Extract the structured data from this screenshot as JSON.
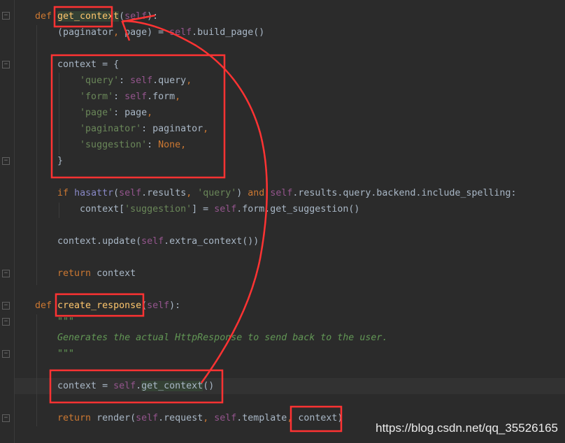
{
  "editor": {
    "lines": [
      [
        [
          "def ",
          "kw"
        ],
        [
          "get_context",
          "fn hl"
        ],
        [
          "(",
          ""
        ],
        [
          "self",
          "self"
        ],
        [
          "):",
          ""
        ]
      ],
      [
        [
          "    (paginator",
          ""
        ],
        [
          ", ",
          "kw"
        ],
        [
          "page) = ",
          ""
        ],
        [
          "self",
          "self"
        ],
        [
          ".build_page()",
          ""
        ]
      ],
      [],
      [
        [
          "    context = {",
          ""
        ]
      ],
      [
        [
          "        ",
          ""
        ],
        [
          "'query'",
          "str"
        ],
        [
          ": ",
          ""
        ],
        [
          "self",
          "self"
        ],
        [
          ".query",
          ""
        ],
        [
          ",",
          "kw"
        ]
      ],
      [
        [
          "        ",
          ""
        ],
        [
          "'form'",
          "str"
        ],
        [
          ": ",
          ""
        ],
        [
          "self",
          "self"
        ],
        [
          ".form",
          ""
        ],
        [
          ",",
          "kw"
        ]
      ],
      [
        [
          "        ",
          ""
        ],
        [
          "'page'",
          "str"
        ],
        [
          ": page",
          ""
        ],
        [
          ",",
          "kw"
        ]
      ],
      [
        [
          "        ",
          ""
        ],
        [
          "'paginator'",
          "str"
        ],
        [
          ": paginator",
          ""
        ],
        [
          ",",
          "kw"
        ]
      ],
      [
        [
          "        ",
          ""
        ],
        [
          "'suggestion'",
          "str"
        ],
        [
          ": ",
          ""
        ],
        [
          "None",
          "none"
        ],
        [
          ",",
          "kw"
        ]
      ],
      [
        [
          "    }",
          ""
        ]
      ],
      [],
      [
        [
          "    ",
          ""
        ],
        [
          "if ",
          "kw"
        ],
        [
          "hasattr",
          "bi"
        ],
        [
          "(",
          ""
        ],
        [
          "self",
          "self"
        ],
        [
          ".results",
          ""
        ],
        [
          ", ",
          "kw"
        ],
        [
          "'query'",
          "str"
        ],
        [
          ") ",
          ""
        ],
        [
          "and ",
          "kw"
        ],
        [
          "self",
          "self"
        ],
        [
          ".results.query.backend.include_spelling:",
          ""
        ]
      ],
      [
        [
          "        context[",
          ""
        ],
        [
          "'suggestion'",
          "str"
        ],
        [
          "] = ",
          ""
        ],
        [
          "self",
          "self"
        ],
        [
          ".form.get_suggestion()",
          ""
        ]
      ],
      [],
      [
        [
          "    context.update(",
          ""
        ],
        [
          "self",
          "self"
        ],
        [
          ".extra_context())",
          ""
        ]
      ],
      [],
      [
        [
          "    ",
          ""
        ],
        [
          "return ",
          "kw"
        ],
        [
          "context",
          ""
        ]
      ],
      [],
      [
        [
          "def ",
          "kw"
        ],
        [
          "create_response",
          "fn"
        ],
        [
          "(",
          ""
        ],
        [
          "self",
          "self"
        ],
        [
          "):",
          ""
        ]
      ],
      [
        [
          "    ",
          ""
        ],
        [
          "\"\"\"",
          "doc"
        ]
      ],
      [
        [
          "    ",
          ""
        ],
        [
          "Generates the actual HttpResponse to send back to the user.",
          "doc"
        ]
      ],
      [
        [
          "    ",
          ""
        ],
        [
          "\"\"\"",
          "doc"
        ]
      ],
      [],
      [
        [
          "    context = ",
          ""
        ],
        [
          "self",
          "self"
        ],
        [
          ".",
          ""
        ],
        [
          "get_context",
          "hl"
        ],
        [
          "()",
          ""
        ]
      ],
      [],
      [
        [
          "    ",
          ""
        ],
        [
          "return ",
          "kw"
        ],
        [
          "render(",
          ""
        ],
        [
          "self",
          "self"
        ],
        [
          ".request",
          ""
        ],
        [
          ", ",
          "kw"
        ],
        [
          "self",
          "self"
        ],
        [
          ".template",
          ""
        ],
        [
          ", ",
          "kw"
        ],
        [
          "context)",
          ""
        ]
      ]
    ]
  },
  "annotation_color": "#ff3333",
  "watermark": "https://blog.csdn.net/qq_35526165"
}
